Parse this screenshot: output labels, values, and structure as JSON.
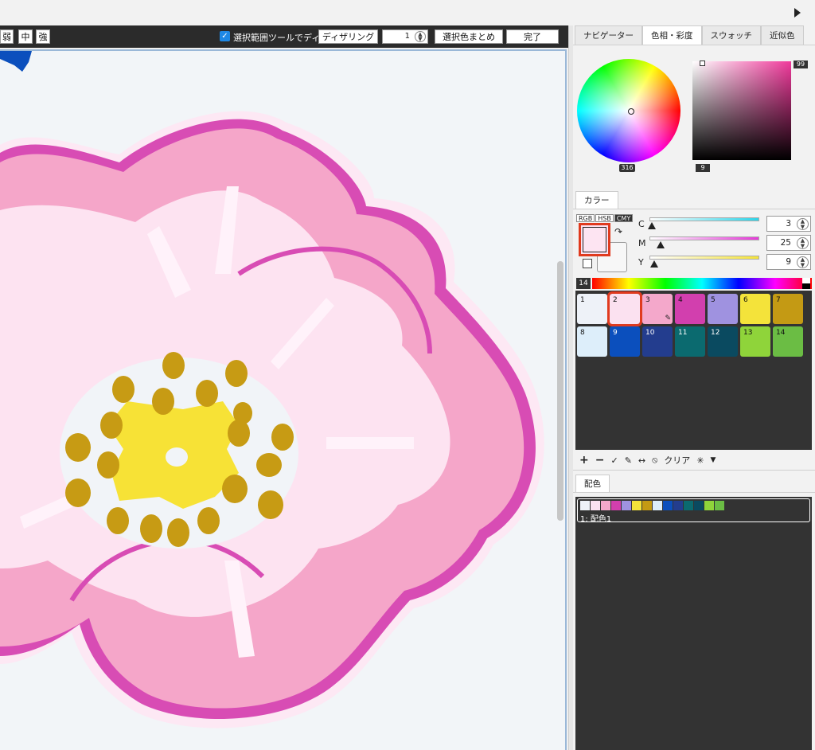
{
  "toolbar": {
    "weak": "弱",
    "medium": "中",
    "strong": "強",
    "dither_checkbox_label": "選択範囲ツールでディザ",
    "dithering_button": "ディザリング",
    "dither_level": "1",
    "merge_colors_button": "選択色まとめ",
    "done_button": "完了"
  },
  "panel_tabs": [
    "ナビゲーター",
    "色相・彩度",
    "スウォッチ",
    "近似色"
  ],
  "wheel": {
    "hue_value": "316",
    "saturation_value": "99",
    "brightness_value": "9"
  },
  "color_section": {
    "tab": "カラー",
    "modes": [
      "RGB",
      "HSB",
      "CMY"
    ],
    "sliders": [
      {
        "label": "C",
        "value": "3"
      },
      {
        "label": "M",
        "value": "25"
      },
      {
        "label": "Y",
        "value": "9"
      }
    ],
    "palette_count": "14",
    "main_color": "#fde4f2"
  },
  "swatches": [
    {
      "num": "1",
      "color": "#eef2f8"
    },
    {
      "num": "2",
      "color": "#fbe1f0",
      "selected": true
    },
    {
      "num": "3",
      "color": "#f4a8cb"
    },
    {
      "num": "4",
      "color": "#d23fae"
    },
    {
      "num": "5",
      "color": "#9f92e0"
    },
    {
      "num": "6",
      "color": "#f4e33a"
    },
    {
      "num": "7",
      "color": "#c49a14"
    },
    {
      "num": "8",
      "color": "#ddeefa"
    },
    {
      "num": "9",
      "color": "#0b4fbd"
    },
    {
      "num": "10",
      "color": "#233d8e"
    },
    {
      "num": "11",
      "color": "#0b6a6f"
    },
    {
      "num": "12",
      "color": "#0a4a60"
    },
    {
      "num": "13",
      "color": "#8fd43a"
    },
    {
      "num": "14",
      "color": "#6bbd44"
    }
  ],
  "palette_tools": {
    "add": "+",
    "remove": "−",
    "check": "✓",
    "edit": "✎",
    "swap": "↔",
    "ban": "⦸",
    "clear": "クリア",
    "effect": "✳",
    "menu": "▼"
  },
  "scheme_section": {
    "tab": "配色",
    "item_label": "1: 配色1"
  },
  "flower_colors": {
    "bg": "#f2f5f8",
    "outline": "#d84cb4",
    "petal_mid": "#f5a6c9",
    "petal_light": "#fde3f1",
    "highlight": "#fff2fa",
    "center_white": "#f1f4f8",
    "pollen_yellow": "#f7e236",
    "stamen": "#c79b14",
    "blue": "#0b4fbd"
  }
}
